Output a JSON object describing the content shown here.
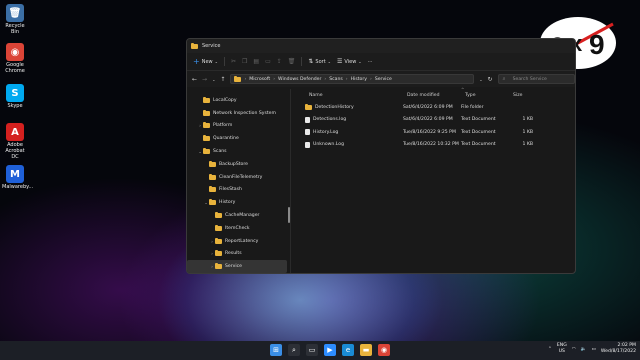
{
  "desktop": {
    "icons": [
      {
        "label": "Recycle Bin",
        "icon": "recycle-bin-icon",
        "glyph": "🗑",
        "color": "#3b6ea5"
      },
      {
        "label": "Google Chrome",
        "icon": "chrome-icon",
        "glyph": "◉",
        "color": "#db4437"
      },
      {
        "label": "Skype",
        "icon": "skype-icon",
        "glyph": "S",
        "color": "#00a9f0"
      },
      {
        "label": "Adobe Acrobat DC",
        "icon": "acrobat-icon",
        "glyph": "A",
        "color": "#d4201f"
      },
      {
        "label": "Malwareby...",
        "icon": "malwarebytes-icon",
        "glyph": "M",
        "color": "#1f60d8"
      }
    ]
  },
  "window": {
    "title": "Service",
    "toolbar": {
      "new_label": "New",
      "sort_label": "Sort",
      "view_label": "View",
      "more_label": "···"
    },
    "breadcrumb": [
      "Microsoft",
      "Windows Defender",
      "Scans",
      "History",
      "Service"
    ],
    "search_placeholder": "Search Service",
    "sidebar": [
      {
        "label": "LocalCopy",
        "indent": 2,
        "chevron": ""
      },
      {
        "label": "Network Inspection System",
        "indent": 2,
        "chevron": ""
      },
      {
        "label": "Platform",
        "indent": 2,
        "chevron": "›"
      },
      {
        "label": "Quarantine",
        "indent": 2,
        "chevron": ""
      },
      {
        "label": "Scans",
        "indent": 2,
        "chevron": "⌄"
      },
      {
        "label": "BackupStore",
        "indent": 3,
        "chevron": ""
      },
      {
        "label": "CleanFileTelemetry",
        "indent": 3,
        "chevron": ""
      },
      {
        "label": "FilesStash",
        "indent": 3,
        "chevron": ""
      },
      {
        "label": "History",
        "indent": 3,
        "chevron": "⌄"
      },
      {
        "label": "CacheManager",
        "indent": 4,
        "chevron": ""
      },
      {
        "label": "ItemCheck",
        "indent": 4,
        "chevron": ""
      },
      {
        "label": "ReportLatency",
        "indent": 4,
        "chevron": "›"
      },
      {
        "label": "Results",
        "indent": 4,
        "chevron": "›"
      },
      {
        "label": "Service",
        "indent": 4,
        "chevron": "›",
        "selected": true
      }
    ],
    "columns": {
      "name": "Name",
      "date": "Date modified",
      "type": "Type",
      "size": "Size"
    },
    "files": [
      {
        "name": "DetectionHistory",
        "date": "Sat/6/4/2022 6:09 PM",
        "type": "File folder",
        "size": "",
        "kind": "folder"
      },
      {
        "name": "Detections.log",
        "date": "Sat/6/4/2022 6:09 PM",
        "type": "Text Document",
        "size": "1 KB",
        "kind": "file"
      },
      {
        "name": "History.Log",
        "date": "Tue/8/16/2022 9:25 PM",
        "type": "Text Document",
        "size": "1 KB",
        "kind": "file"
      },
      {
        "name": "Unknown.Log",
        "date": "Tue/8/16/2022 10:32 PM",
        "type": "Text Document",
        "size": "1 KB",
        "kind": "file"
      }
    ]
  },
  "taskbar": {
    "apps": [
      {
        "name": "start-icon",
        "glyph": "⊞",
        "color": "#3a8ee6"
      },
      {
        "name": "search-icon",
        "glyph": "⌕",
        "color": "#2c2f36"
      },
      {
        "name": "task-view-icon",
        "glyph": "▭",
        "color": "#2c2f36"
      },
      {
        "name": "zoom-icon",
        "glyph": "▶",
        "color": "#2d8cff"
      },
      {
        "name": "edge-icon",
        "glyph": "e",
        "color": "#1a8bd4"
      },
      {
        "name": "file-explorer-icon",
        "glyph": "▬",
        "color": "#e8b33c"
      },
      {
        "name": "chrome-icon",
        "glyph": "◉",
        "color": "#db4437"
      }
    ],
    "lang_top": "ENG",
    "lang_bottom": "US",
    "time": "2:02 PM",
    "date": "Wed/8/17/2022"
  },
  "colors": {
    "accent": "#3a8ee6",
    "folder": "#e8b33c",
    "logo_red": "#d82020"
  }
}
